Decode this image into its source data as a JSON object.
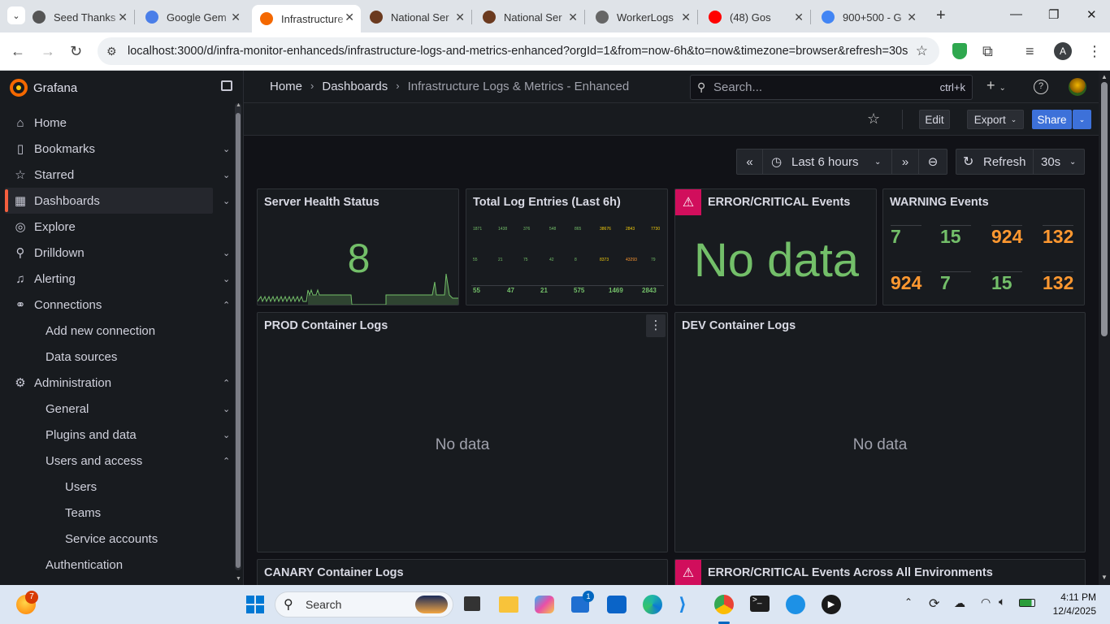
{
  "browser": {
    "tabs": [
      {
        "title": "Seed Thanks",
        "icon": "gear-favicon-icon",
        "color": "#555"
      },
      {
        "title": "Google Gem",
        "icon": "gemini-icon",
        "color": "#4a7ee8"
      },
      {
        "title": "Infrastructure",
        "icon": "grafana-favicon-icon",
        "color": "#f46800",
        "active": true
      },
      {
        "title": "National Ser",
        "icon": "national-emblem-icon",
        "color": "#6b3a1f"
      },
      {
        "title": "National Ser",
        "icon": "national-emblem-icon",
        "color": "#6b3a1f"
      },
      {
        "title": "WorkerLogs",
        "icon": "globe-icon",
        "color": "#666"
      },
      {
        "title": "(48) Gos",
        "icon": "youtube-icon",
        "color": "#ff0000"
      },
      {
        "title": "900+500 - G",
        "icon": "google-icon",
        "color": "#4285f4"
      }
    ],
    "url": "localhost:3000/d/infra-monitor-enhanceds/infrastructure-logs-and-metrics-enhanced?orgId=1&from=now-6h&to=now&timezone=browser&refresh=30s",
    "profile_initial": "A"
  },
  "grafana": {
    "brand": "Grafana",
    "sidebar": [
      {
        "label": "Home",
        "icon": "home-icon",
        "glyph": "⌂",
        "level": 0
      },
      {
        "label": "Bookmarks",
        "icon": "bookmark-icon",
        "glyph": "▯",
        "level": 0,
        "chev": "⌄"
      },
      {
        "label": "Starred",
        "icon": "star-icon",
        "glyph": "☆",
        "level": 0,
        "chev": "⌄"
      },
      {
        "label": "Dashboards",
        "icon": "dashboards-icon",
        "glyph": "▦",
        "level": 0,
        "chev": "⌄",
        "active": true
      },
      {
        "label": "Explore",
        "icon": "explore-icon",
        "glyph": "◎",
        "level": 0
      },
      {
        "label": "Drilldown",
        "icon": "drilldown-icon",
        "glyph": "⚲",
        "level": 0,
        "chev": "⌄"
      },
      {
        "label": "Alerting",
        "icon": "bell-icon",
        "glyph": "♫",
        "level": 0,
        "chev": "⌄"
      },
      {
        "label": "Connections",
        "icon": "connections-icon",
        "glyph": "⚭",
        "level": 0,
        "chev": "⌃"
      },
      {
        "label": "Add new connection",
        "level": 1
      },
      {
        "label": "Data sources",
        "level": 1
      },
      {
        "label": "Administration",
        "icon": "cog-icon",
        "glyph": "⚙",
        "level": 0,
        "chev": "⌃"
      },
      {
        "label": "General",
        "level": 1,
        "chev": "⌄"
      },
      {
        "label": "Plugins and data",
        "level": 1,
        "chev": "⌄"
      },
      {
        "label": "Users and access",
        "level": 1,
        "chev": "⌃"
      },
      {
        "label": "Users",
        "level": 2
      },
      {
        "label": "Teams",
        "level": 2
      },
      {
        "label": "Service accounts",
        "level": 2
      },
      {
        "label": "Authentication",
        "level": 1
      }
    ],
    "breadcrumb": {
      "home": "Home",
      "dashboards": "Dashboards",
      "current": "Infrastructure Logs & Metrics - Enhanced"
    },
    "search": {
      "placeholder": "Search...",
      "shortcut": "ctrl+k"
    },
    "toolbar": {
      "edit": "Edit",
      "export": "Export",
      "share": "Share"
    },
    "time": {
      "range": "Last 6 hours",
      "refresh": "Refresh",
      "interval": "30s"
    },
    "panels": {
      "health": {
        "title": "Server Health Status",
        "value": "8"
      },
      "logs": {
        "title": "Total Log Entries (Last 6h)",
        "row1": [
          "1871",
          "1438",
          "376",
          "548",
          "865",
          "38676",
          "2843",
          "7730"
        ],
        "row2": [
          "55",
          "21",
          "75",
          "42",
          "8",
          "8373",
          "43293",
          "79"
        ],
        "row3": [
          "55",
          "47",
          "21",
          "575",
          "1469",
          "2843"
        ]
      },
      "errors": {
        "title": "ERROR/CRITICAL Events",
        "value": "No data"
      },
      "warnings": {
        "title": "WARNING Events",
        "values": [
          "7",
          "15",
          "924",
          "132",
          "924",
          "7",
          "15",
          "132"
        ]
      },
      "prod": {
        "title": "PROD Container Logs",
        "value": "No data"
      },
      "dev": {
        "title": "DEV Container Logs",
        "value": "No data"
      },
      "canary": {
        "title": "CANARY Container Logs"
      },
      "errors_all": {
        "title": "ERROR/CRITICAL Events Across All Environments"
      }
    }
  },
  "taskbar": {
    "search": "Search",
    "notif_badge": "7",
    "store_badge": "1",
    "time": "4:11 PM",
    "date": "12/4/2025"
  },
  "colors": {
    "accent": "#f55f3e",
    "green": "#73bf69",
    "orange": "#ff9830",
    "primary": "#3d71d9",
    "error": "#d10e5c"
  }
}
